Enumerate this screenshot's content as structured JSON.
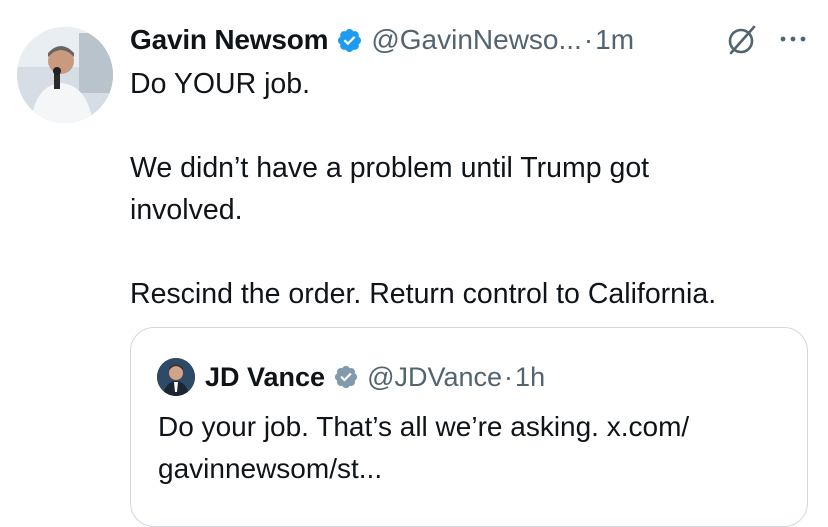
{
  "tweet": {
    "author": {
      "display_name": "Gavin Newsom",
      "handle": "@GavinNewso...",
      "verified_icon": "verified-badge-blue",
      "avatar_icon": "profile-photo"
    },
    "separator": "·",
    "time": "1m",
    "actions": {
      "grok_icon": "grok-icon",
      "more_icon": "more-options-icon"
    },
    "body": {
      "line1": "Do YOUR job.",
      "line2": "We didn’t have a problem until Trump got involved.",
      "line3": "Rescind the order. Return control to California."
    },
    "quote": {
      "author": {
        "display_name": "JD Vance",
        "handle": "@JDVance",
        "verified_icon": "verified-badge-gray",
        "avatar_icon": "profile-photo"
      },
      "separator": "·",
      "time": "1h",
      "text": "Do your job. That’s all we’re asking. x.com/\ngavinnewsom/st..."
    }
  },
  "colors": {
    "text_primary": "#0f1419",
    "text_secondary": "#536471",
    "verified_blue": "#1d9bf0",
    "verified_gray": "#829aab",
    "card_border": "#cfd9de"
  }
}
